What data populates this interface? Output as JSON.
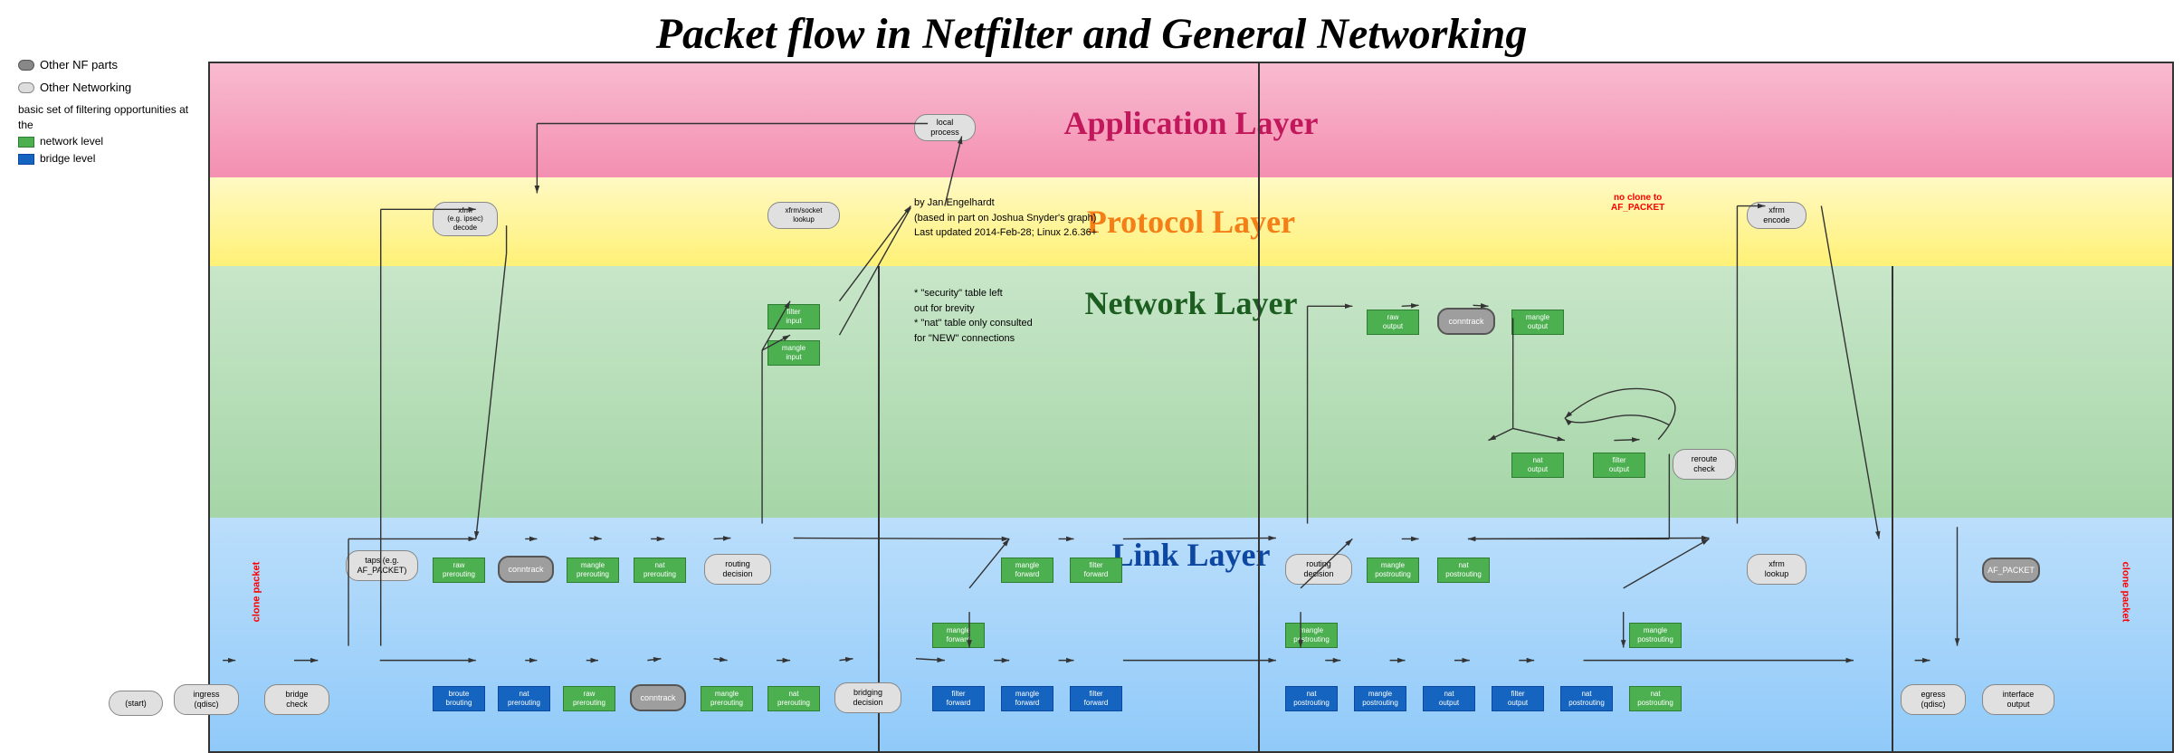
{
  "title": "Packet flow in Netfilter and General Networking",
  "legend": {
    "nf_parts": "Other NF parts",
    "other_networking": "Other Networking",
    "basic_filtering": "basic set of filtering opportunities at the",
    "network_level": "network level",
    "bridge_level": "bridge level"
  },
  "layers": {
    "application": "Application Layer",
    "protocol": "Protocol Layer",
    "network": "Network Layer",
    "link": "Link Layer"
  },
  "info": {
    "author": "by Jan Engelhardt",
    "based": "(based in part on Joshua Snyder's graph)",
    "updated": "Last updated 2014-Feb-28; Linux 2.6.36+",
    "note1": "* \"security\" table left",
    "note2": "  out for brevity",
    "note3": "* \"nat\" table only consulted",
    "note4": "  for \"NEW\" connections"
  },
  "nodes": {
    "start": "(start)",
    "ingress": "ingress\n(qdisc)",
    "bridge_check": "bridge\ncheck",
    "broute_brouting": "broute\nbrouting",
    "nat_prerouting_link": "nat\nprerouting",
    "raw_prerouting_link": "raw\nprerouting",
    "conntrack_link": "conntrack",
    "mangle_prerouting_link": "mangle\nprerouting",
    "nat_prerouting2_link": "nat\nprerouting",
    "bridging_decision": "bridging\ndecision",
    "filter_forward_link1": "filter\nforward",
    "mangle_forward_link": "mangle\nforward",
    "filter_forward_link2": "filter\nforward",
    "nat_postrouting_link1": "nat\npostrouting",
    "mangle_postrouting_link1": "mangle\npostrouting",
    "nat_postrouting_link2": "nat\npostrouting",
    "nat_output_link": "nat\noutput",
    "filter_output_link": "filter\noutput",
    "nat_postrouting_link3": "nat\npostrouting",
    "egress": "egress\n(qdisc)",
    "interface_output": "interface\noutput",
    "taps": "taps (e.g.\nAF_PACKET)",
    "raw_prerouting_net": "raw\nprerouting",
    "conntrack_net": "conntrack",
    "mangle_prerouting_net": "mangle\nprerouting",
    "nat_prerouting_net": "nat\nprerouting",
    "routing_decision_net": "routing\ndecision",
    "filter_input_net": "filter\ninput",
    "mangle_input_net": "mangle\ninput",
    "local_process": "local\nprocess",
    "xfrm_decode": "xfrm\n(e.g. ipsec)\ndecode",
    "xfrm_socket_lookup": "xfrm/socket\nlookup",
    "mangle_forward_net": "mangle\nforward",
    "filter_forward_net": "filter\nforward",
    "raw_output_net": "raw\noutput",
    "conntrack_out_net": "conntrack",
    "mangle_output_net": "mangle\noutput",
    "filter_output_net": "filter\noutput",
    "nat_output_net": "nat\noutput",
    "reroute_check": "reroute\ncheck",
    "mangle_postrouting_net": "mangle\npostrouting",
    "nat_postrouting_net": "nat\npostrouting",
    "xfrm_lookup": "xfrm\nlookup",
    "xfrm_encode": "xfrm\nencode",
    "routing_decision2": "routing\ndecision",
    "AF_PACKET": "AF_PACKET",
    "clone_left": "clone packet",
    "clone_right": "clone packet",
    "mangle_forward_link2": "mangle\nforward",
    "mangle_postrouting_link2": "mangle\npostrouting",
    "mangle_postrouting_link3": "mangle\npostrouting"
  }
}
